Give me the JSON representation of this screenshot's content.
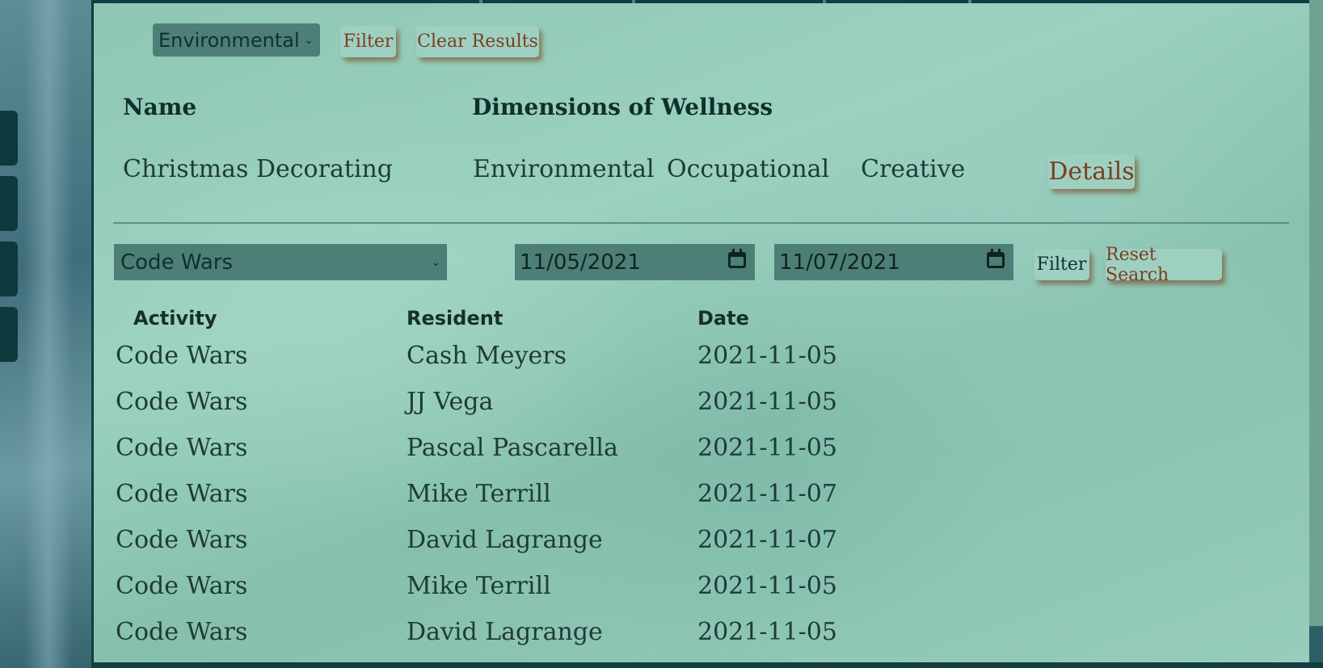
{
  "wellness_filter": {
    "selected": "Environmental",
    "filter_label": "Filter",
    "clear_label": "Clear Results"
  },
  "wellness_table": {
    "headers": {
      "name": "Name",
      "dimensions": "Dimensions of Wellness"
    },
    "rows": [
      {
        "name": "Christmas Decorating",
        "dims": [
          "Environmental",
          "Occupational",
          "Creative"
        ],
        "details_label": "Details"
      }
    ]
  },
  "activity_filter": {
    "selected": "Code Wars",
    "start_date": "11/05/2021",
    "end_date": "11/07/2021",
    "filter_label": "Filter",
    "reset_label": "Reset Search"
  },
  "attendance_table": {
    "headers": {
      "activity": "Activity",
      "resident": "Resident",
      "date": "Date"
    },
    "rows": [
      {
        "activity": "Code Wars",
        "resident": "Cash Meyers",
        "date": "2021-11-05"
      },
      {
        "activity": "Code Wars",
        "resident": "JJ Vega",
        "date": "2021-11-05"
      },
      {
        "activity": "Code Wars",
        "resident": "Pascal Pascarella",
        "date": "2021-11-05"
      },
      {
        "activity": "Code Wars",
        "resident": "Mike Terrill",
        "date": "2021-11-07"
      },
      {
        "activity": "Code Wars",
        "resident": "David Lagrange",
        "date": "2021-11-07"
      },
      {
        "activity": "Code Wars",
        "resident": "Mike Terrill",
        "date": "2021-11-05"
      },
      {
        "activity": "Code Wars",
        "resident": "David Lagrange",
        "date": "2021-11-05"
      }
    ]
  },
  "colors": {
    "panel": "#96cdbb",
    "dark_border": "#103e41",
    "button_text": "#7a3f1e",
    "select_bg": "#4e7f77"
  }
}
